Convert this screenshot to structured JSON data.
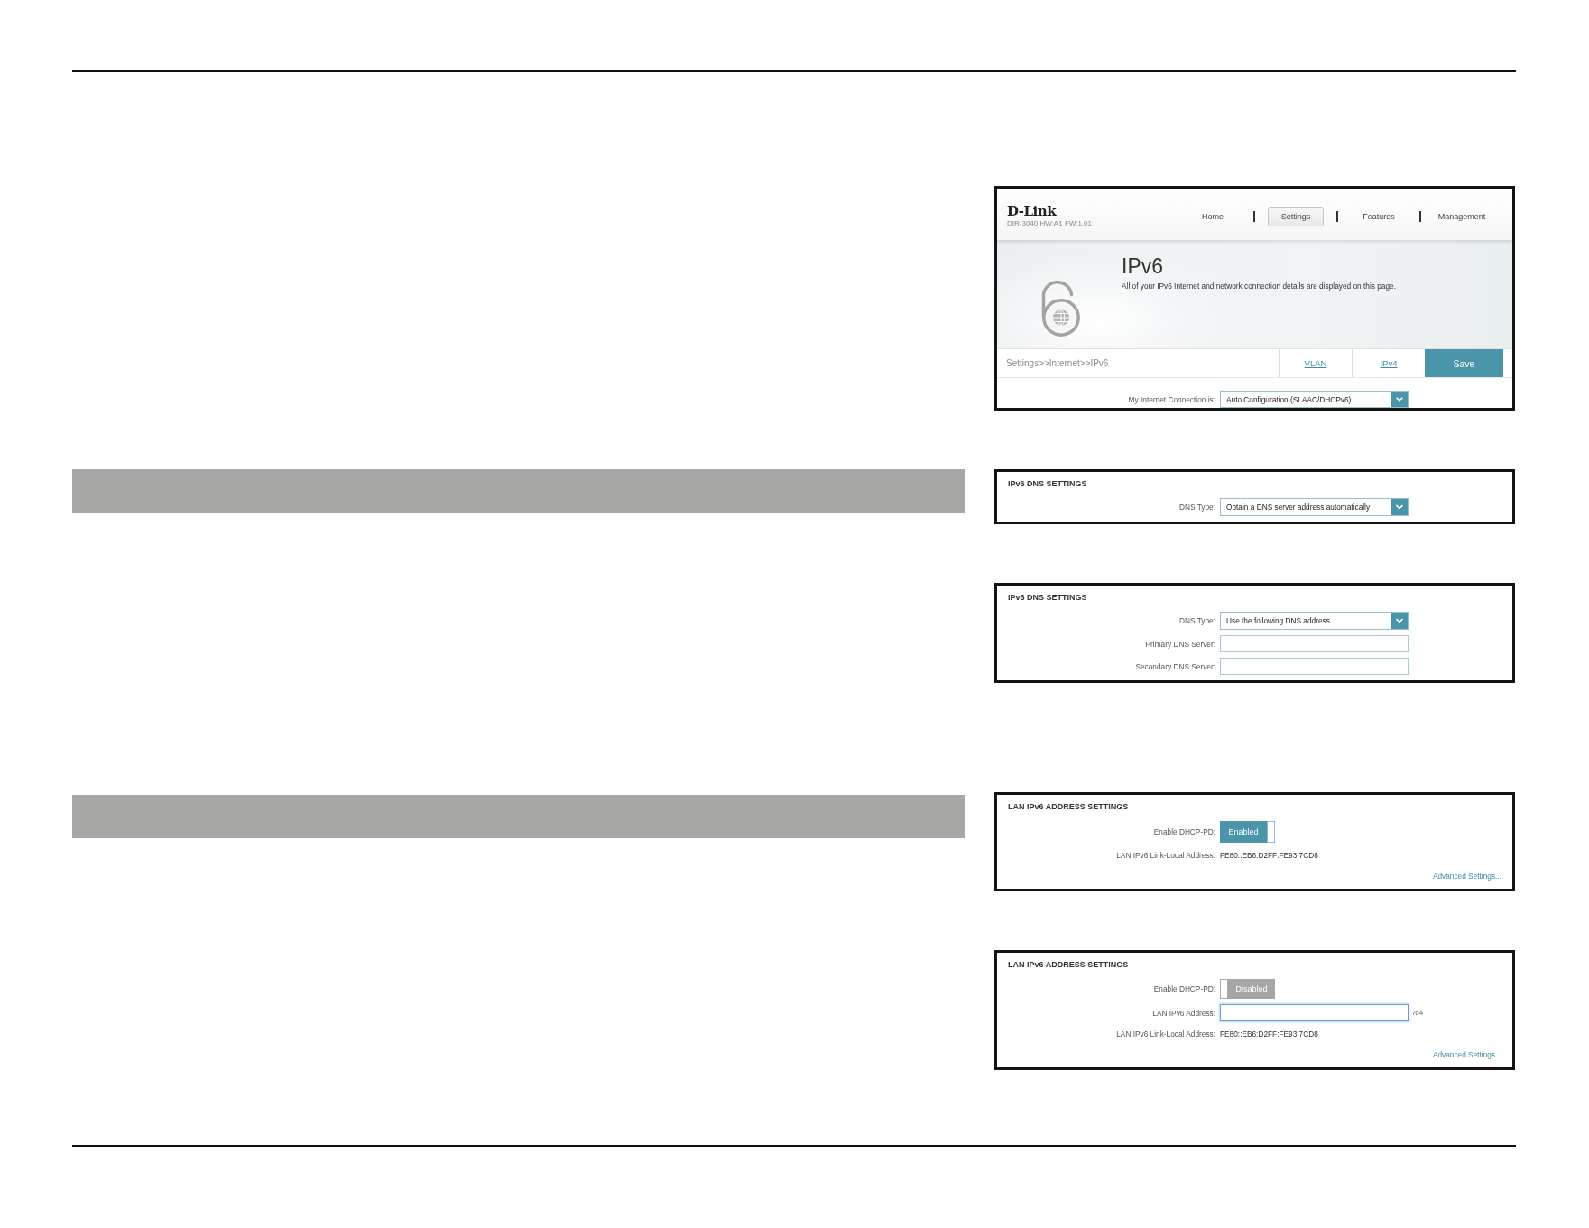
{
  "screenshots": [
    {
      "kind": "router_page",
      "header": {
        "logo": "D-Link",
        "model": "DIR-3040 HW:A1 FW:1.01",
        "nav": [
          {
            "label": "Home",
            "selected": false
          },
          {
            "label": "Settings",
            "selected": true
          },
          {
            "label": "Features",
            "selected": false
          },
          {
            "label": "Management",
            "selected": false
          }
        ]
      },
      "banner": {
        "title": "IPv6",
        "description": "All of your IPv6 Internet and network connection details are displayed on this page."
      },
      "breadcrumb": "Settings>>Internet>>IPv6",
      "links": [
        "VLAN",
        "IPv4"
      ],
      "save_button": "Save",
      "fields": [
        {
          "kind": "select",
          "label": "My Internet Connection is:",
          "value": "Auto Configuration (SLAAC/DHCPv6)"
        }
      ]
    },
    {
      "kind": "settings_panel",
      "title": "IPv6 DNS SETTINGS",
      "fields": [
        {
          "kind": "select",
          "label": "DNS Type:",
          "value": "Obtain a DNS server address automatically"
        }
      ]
    },
    {
      "kind": "settings_panel",
      "title": "IPv6 DNS SETTINGS",
      "fields": [
        {
          "kind": "select",
          "label": "DNS Type:",
          "value": "Use the following DNS address"
        },
        {
          "kind": "input",
          "label": "Primary DNS Server:",
          "focused": false
        },
        {
          "kind": "input",
          "label": "Secondary DNS Server:",
          "focused": false
        }
      ]
    },
    {
      "kind": "settings_panel",
      "title": "LAN IPv6 ADDRESS SETTINGS",
      "fields": [
        {
          "kind": "toggle",
          "label": "Enable DHCP-PD:",
          "on": true,
          "state_text": "Enabled"
        },
        {
          "kind": "text",
          "label": "LAN IPv6 Link-Local Address:",
          "value": "FE80::EB6:D2FF:FE93:7CD8"
        }
      ],
      "link": "Advanced Settings..."
    },
    {
      "kind": "settings_panel",
      "title": "LAN IPv6 ADDRESS SETTINGS",
      "fields": [
        {
          "kind": "toggle",
          "label": "Enable DHCP-PD:",
          "on": false,
          "state_text": "Disabled"
        },
        {
          "kind": "input",
          "label": "LAN IPv6 Address:",
          "focused": true,
          "suffix": "/64"
        },
        {
          "kind": "text",
          "label": "LAN IPv6 Link-Local Address:",
          "value": "FE80::EB6:D2FF:FE93:7CD8"
        }
      ],
      "link": "Advanced Settings..."
    }
  ]
}
